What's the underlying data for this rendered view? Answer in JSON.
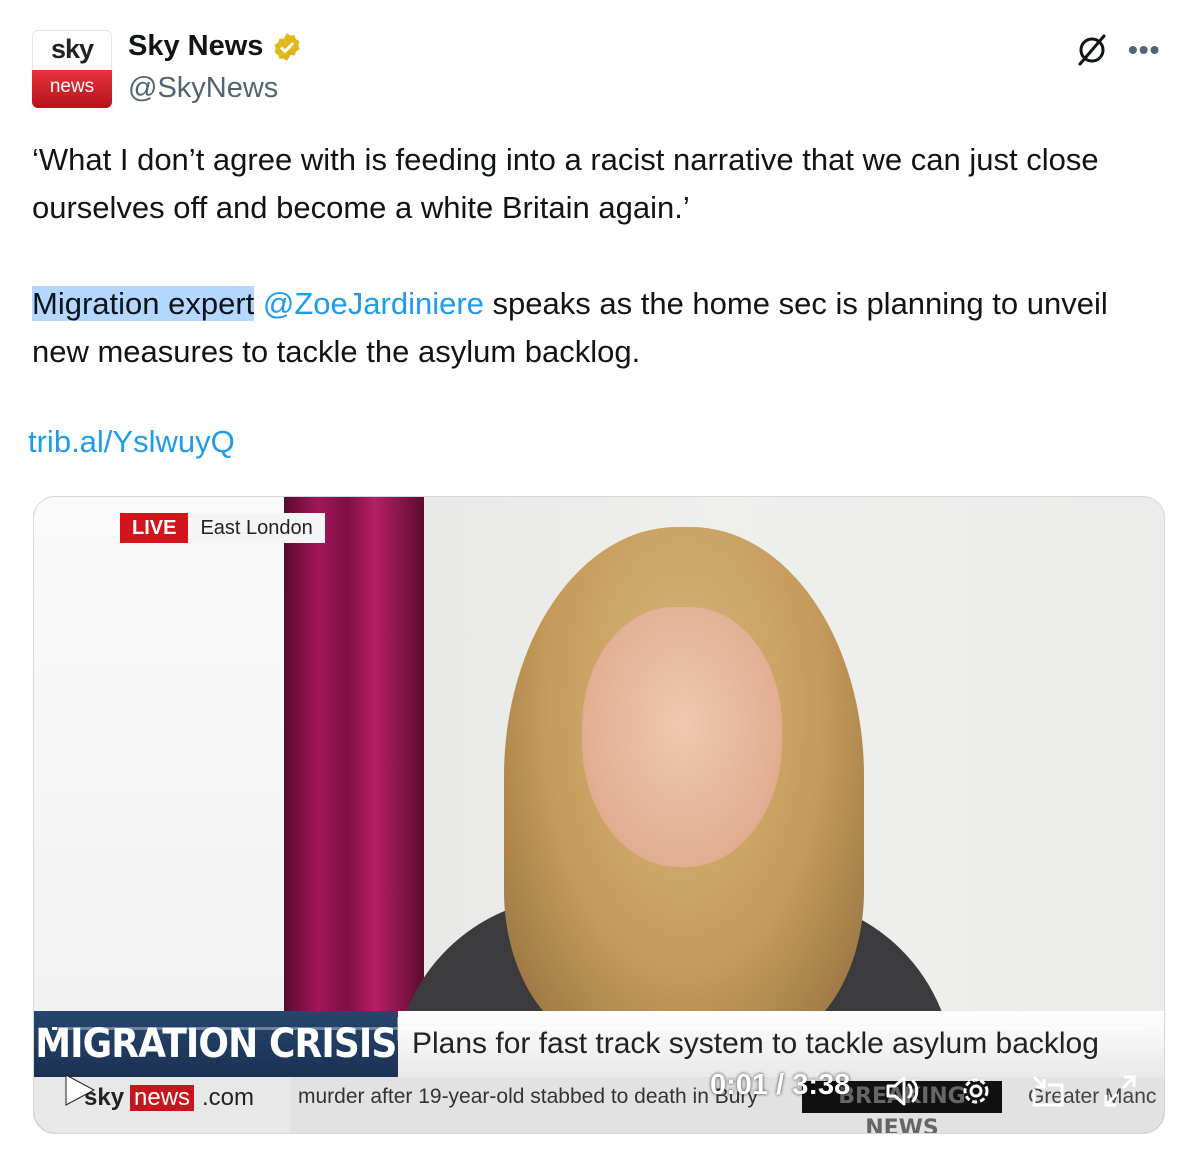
{
  "author": {
    "avatar_top": "sky",
    "avatar_bottom": "news",
    "display_name": "Sky News",
    "handle": "@SkyNews"
  },
  "tweet": {
    "quote": "‘What I don’t agree with is feeding into a racist narrative that we can just close ourselves off and become a white Britain again.’",
    "highlight": "Migration expert",
    "mention": "@ZoeJardiniere",
    "body_rest": " speaks as the home sec is planning to unveil new measures to tackle the asylum backlog.",
    "link": "trib.al/YslwuyQ"
  },
  "video": {
    "live_label": "LIVE",
    "location": "East London",
    "tag": "MIGRATION CRISIS",
    "headline": "Plans for fast track system to tackle asylum backlog",
    "brand_sky": "sky",
    "brand_news": "news",
    "brand_com": ".com",
    "ticker_text": "murder after 19-year-old stabbed to death in Bury",
    "breaking": "BREAKING NEWS",
    "region": "Greater Manc",
    "time": "0:01 / 3:38",
    "progress": 0.005
  },
  "icons": [
    "verified-badge-icon",
    "grok-icon",
    "more-icon",
    "play-icon",
    "volume-icon",
    "settings-icon",
    "pip-icon",
    "fullscreen-icon"
  ],
  "colors": {
    "accent": "#1d9bf0",
    "highlight": "#b3d7ff",
    "verified": "#e2b719",
    "live": "#d4141c"
  }
}
